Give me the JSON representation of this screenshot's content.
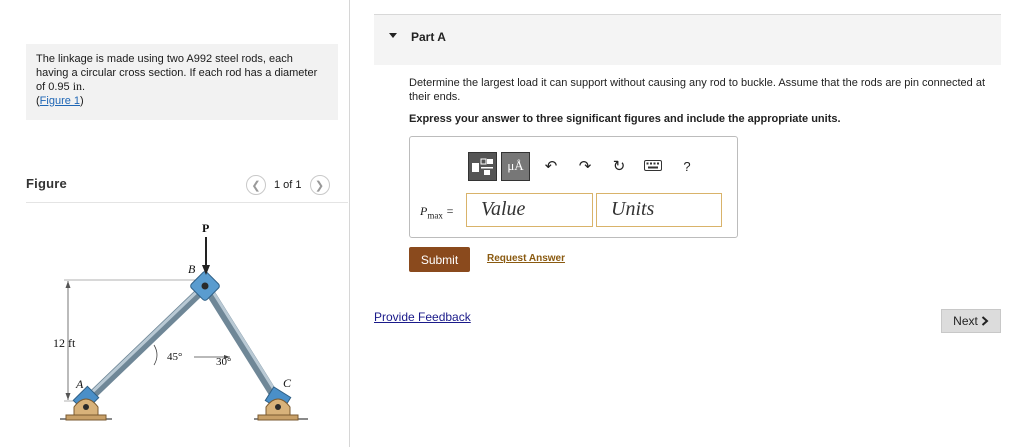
{
  "problem": {
    "text": "The linkage is made using two A992 steel rods, each having a circular cross section. If each rod has a diameter of 0.95",
    "unit": "in",
    "figure_link": "Figure 1"
  },
  "figure_panel": {
    "title": "Figure",
    "pager": "1 of 1",
    "prev_icon": "chevron-left-icon",
    "next_icon": "chevron-right-icon",
    "labels": {
      "load": "P",
      "joint_b": "B",
      "support_a": "A",
      "support_c": "C",
      "height": "12 ft",
      "angle_left": "45°",
      "angle_right": "30°"
    }
  },
  "part": {
    "title": "Part A",
    "question": "Determine the largest load it can support without causing any rod to buckle. Assume that the rods are pin connected at their ends.",
    "instruction": "Express your answer to three significant figures and include the appropriate units."
  },
  "toolbar": {
    "templates_icon": "templates-icon",
    "units_button": "μÅ",
    "undo_icon": "undo-icon",
    "redo_icon": "redo-icon",
    "reset_icon": "reset-icon",
    "keyboard_icon": "keyboard-icon",
    "help": "?"
  },
  "answer": {
    "var": "P",
    "sub": "max",
    "eq": "=",
    "value_placeholder": "Value",
    "units_placeholder": "Units"
  },
  "buttons": {
    "submit": "Submit",
    "request": "Request Answer",
    "feedback": "Provide Feedback",
    "next": "Next"
  },
  "colors": {
    "submit_bg": "#8a4a1d",
    "field_border": "#d9b36a",
    "link": "#1f66b5"
  }
}
